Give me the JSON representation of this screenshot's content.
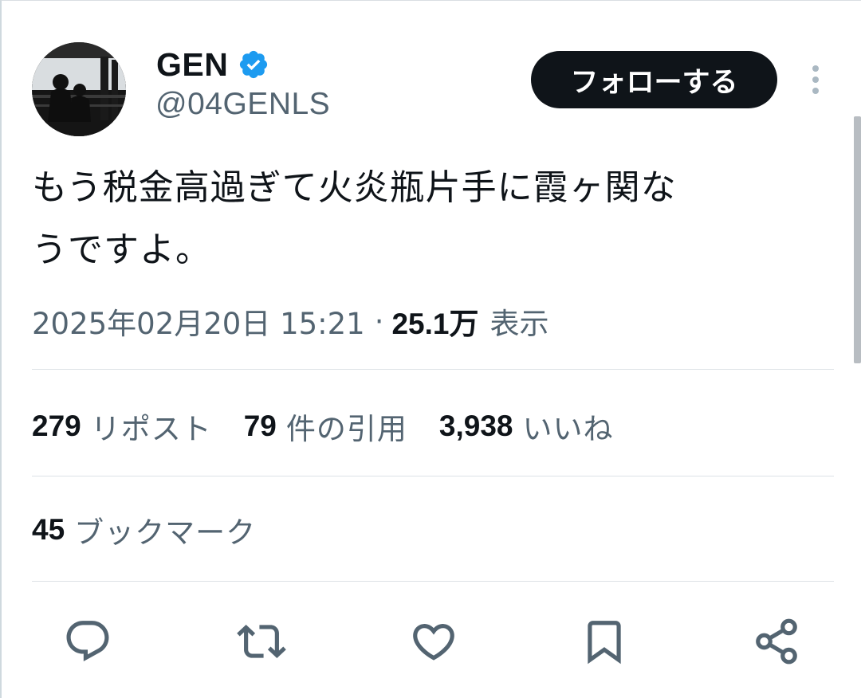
{
  "author": {
    "display_name": "GEN",
    "handle": "@04GENLS",
    "verified_icon": "verified-badge-icon",
    "avatar": "profile-photo"
  },
  "follow_button_label": "フォローする",
  "more_icon": "more-vertical-icon",
  "tweet": {
    "text_line1": "もう税金高過ぎて火炎瓶片手に霞ヶ関な",
    "text_line2": "うですよ。",
    "timestamp": "2025年02月20日 15:21",
    "separator": "·",
    "views_count": "25.1万",
    "views_label": "表示"
  },
  "stats": {
    "reposts_count": "279",
    "reposts_label": "リポスト",
    "quotes_count": "79",
    "quotes_label": "件の引用",
    "likes_count": "3,938",
    "likes_label": "いいね",
    "bookmarks_count": "45",
    "bookmarks_label": "ブックマーク"
  },
  "actions": [
    {
      "name": "reply",
      "icon": "reply-icon"
    },
    {
      "name": "repost",
      "icon": "repost-icon"
    },
    {
      "name": "like",
      "icon": "heart-icon"
    },
    {
      "name": "bookmark",
      "icon": "bookmark-icon"
    },
    {
      "name": "share",
      "icon": "share-icon"
    }
  ],
  "colors": {
    "text_primary": "#0f1419",
    "text_secondary": "#536471",
    "verified_blue": "#1d9bf0",
    "divider": "#dde2e6",
    "follow_bg": "#0f1419"
  }
}
